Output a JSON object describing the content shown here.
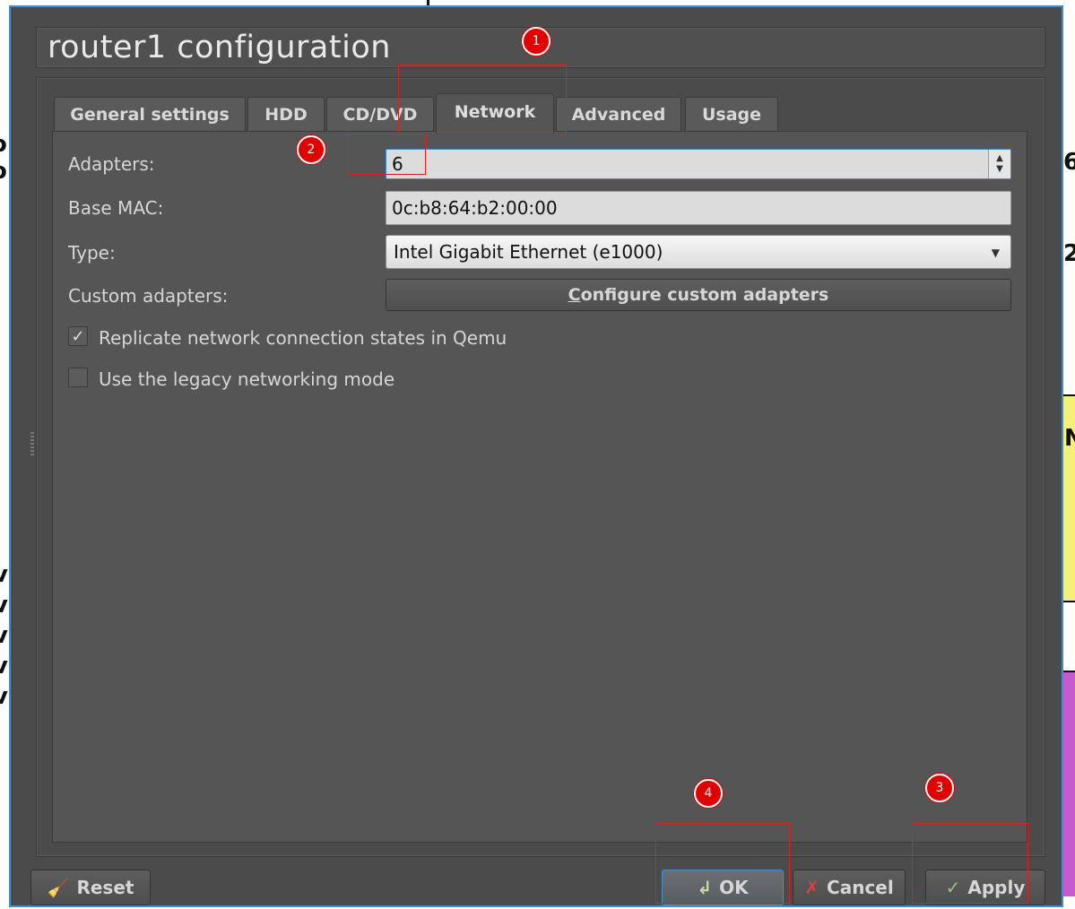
{
  "dialog": {
    "title": "router1 configuration"
  },
  "tabs": [
    {
      "label": "General settings",
      "active": false
    },
    {
      "label": "HDD",
      "active": false
    },
    {
      "label": "CD/DVD",
      "active": false
    },
    {
      "label": "Network",
      "active": true
    },
    {
      "label": "Advanced",
      "active": false
    },
    {
      "label": "Usage",
      "active": false
    }
  ],
  "network": {
    "adapters_label": "Adapters:",
    "adapters_value": "6",
    "base_mac_label": "Base MAC:",
    "base_mac_value": "0c:b8:64:b2:00:00",
    "type_label": "Type:",
    "type_value": "Intel Gigabit Ethernet (e1000)",
    "custom_label": "Custom adapters:",
    "custom_button_underlined": "C",
    "custom_button_rest": "onfigure custom adapters",
    "replicate_label": "Replicate network connection states in Qemu",
    "replicate_checked": true,
    "legacy_label": "Use the legacy networking mode",
    "legacy_checked": false
  },
  "buttons": {
    "reset": "Reset",
    "ok": "OK",
    "cancel": "Cancel",
    "apply": "Apply"
  },
  "annotations": [
    "1",
    "2",
    "3",
    "4"
  ],
  "icons": {
    "reset": "broom-icon",
    "ok": "ok-arrow-icon",
    "cancel": "cancel-x-icon",
    "apply": "checkmark-icon"
  },
  "colors": {
    "accent": "#3d8fd6",
    "dialog_bg": "#4b4b4b",
    "marker_red": "#e10000"
  }
}
